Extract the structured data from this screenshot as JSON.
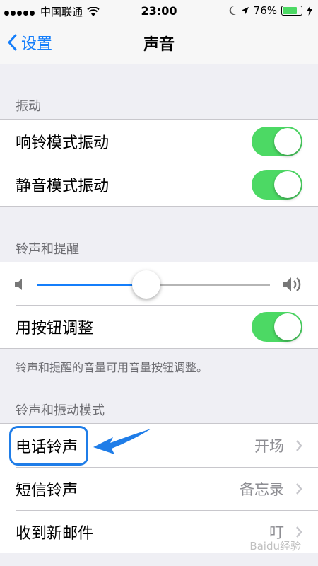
{
  "status_bar": {
    "carrier": "中国联通",
    "time": "23:00",
    "battery": "76%",
    "battery_level": 0.76
  },
  "nav": {
    "back_label": "设置",
    "title": "声音"
  },
  "sections": {
    "vibrate": {
      "header": "振动",
      "items": [
        {
          "label": "响铃模式振动",
          "on": true
        },
        {
          "label": "静音模式振动",
          "on": true
        }
      ]
    },
    "ringer": {
      "header": "铃声和提醒",
      "volume_level": 0.47,
      "change_with_buttons": {
        "label": "用按钮调整",
        "on": true
      },
      "footnote": "铃声和提醒的音量可用音量按钮调整。"
    },
    "patterns": {
      "header": "铃声和振动模式",
      "items": [
        {
          "label": "电话铃声",
          "value": "开场"
        },
        {
          "label": "短信铃声",
          "value": "备忘录"
        },
        {
          "label": "收到新邮件",
          "value": "叮"
        }
      ]
    }
  },
  "watermark": "Baidu经验",
  "colors": {
    "accent": "#147efb",
    "toggle_on": "#4cd964",
    "annotation": "#1f7de8",
    "background": "#efeff4"
  }
}
